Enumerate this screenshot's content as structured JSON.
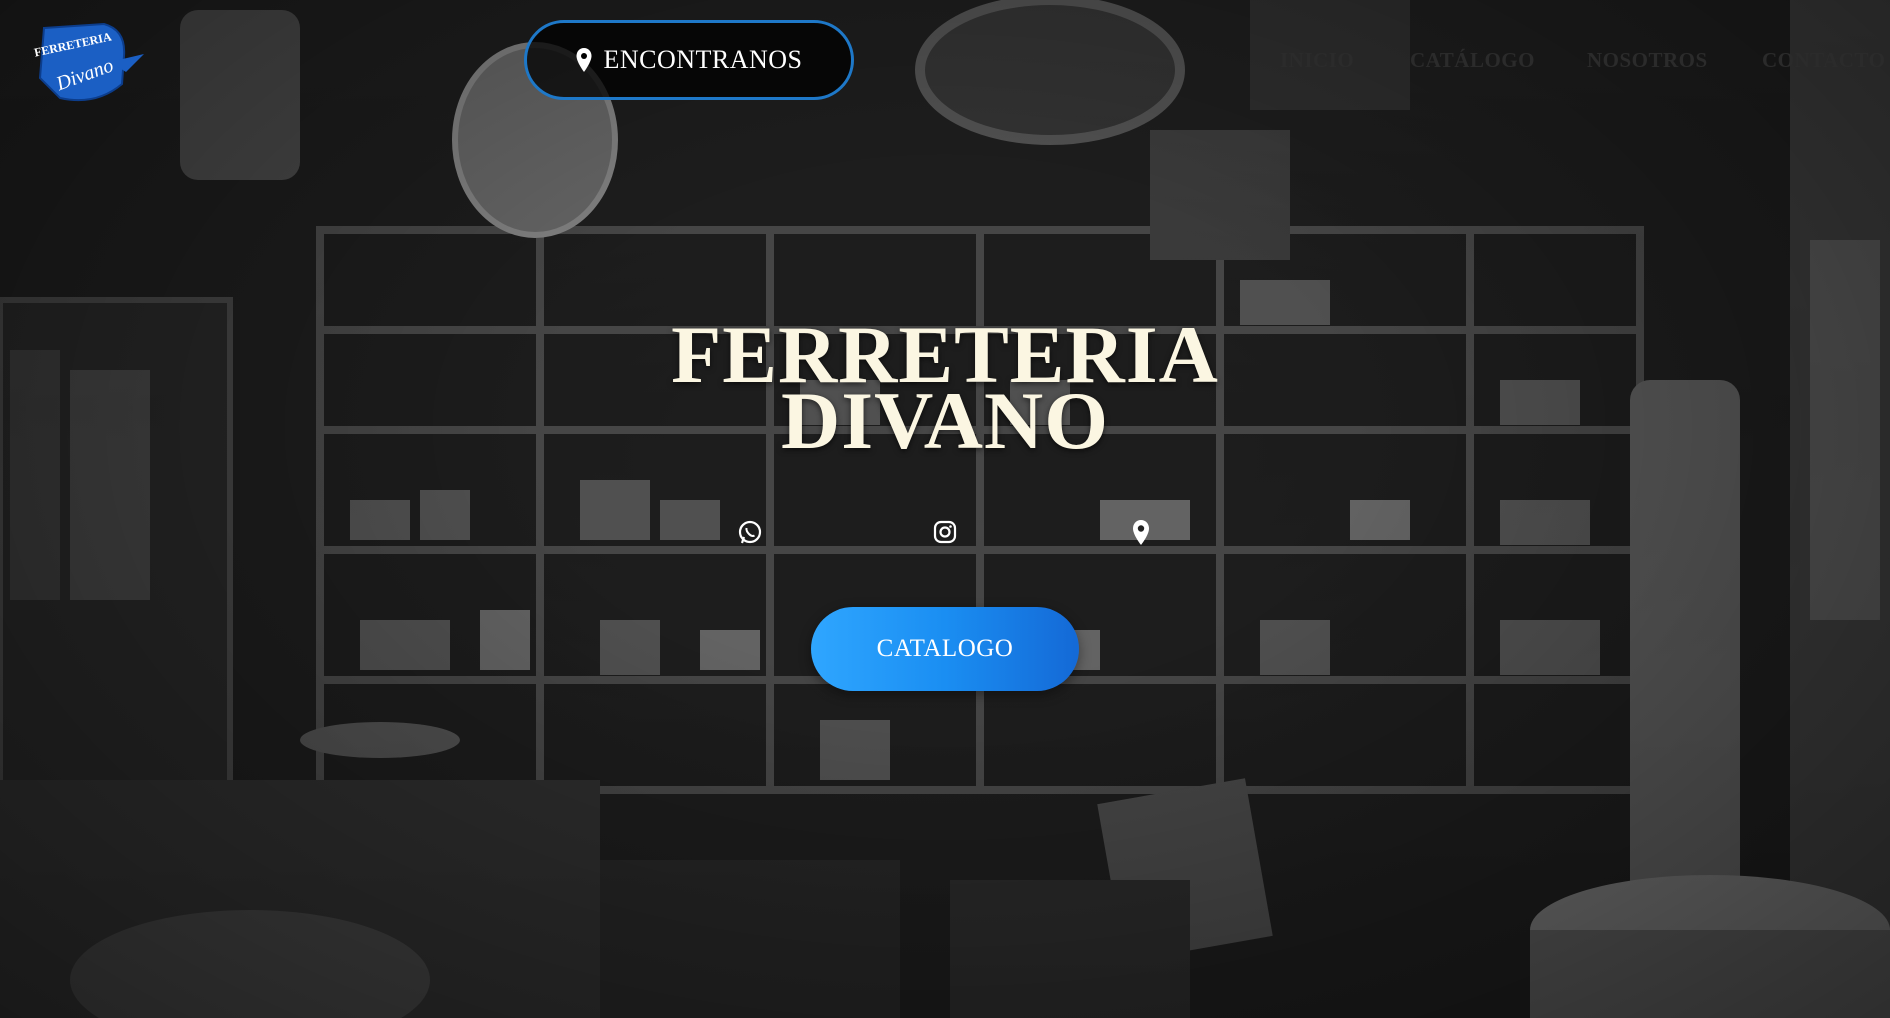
{
  "header": {
    "logo_text_top": "FERRETERIA",
    "logo_text_script": "Divano",
    "find_label": "ENCONTRANOS",
    "nav": [
      {
        "label": "INICIO"
      },
      {
        "label": "CATÁLOGO"
      },
      {
        "label": "NOSOTROS"
      },
      {
        "label": "CONTACTO"
      }
    ]
  },
  "hero": {
    "title_line1": "FERRETERIA",
    "title_line2": "DIVANO",
    "cta_label": "CATALOGO",
    "social_icons": [
      "whatsapp-icon",
      "instagram-icon",
      "location-pin-icon"
    ]
  },
  "colors": {
    "accent_blue": "#1e78c8",
    "cta_gradient_start": "#2fa6ff",
    "cta_gradient_end": "#1469d6",
    "title_cream": "#fbf6e2"
  }
}
